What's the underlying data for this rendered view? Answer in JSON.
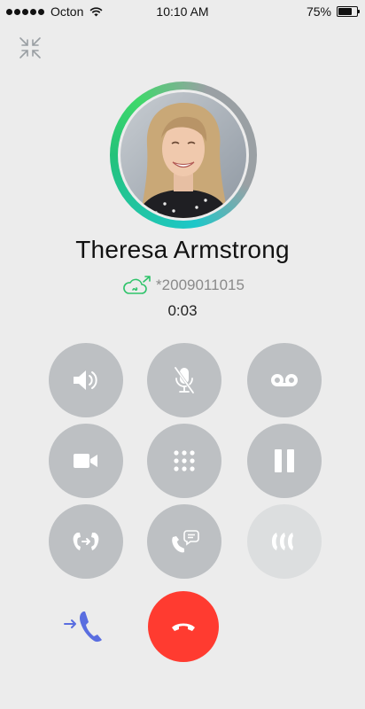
{
  "status_bar": {
    "carrier": "Octon",
    "time": "10:10 AM",
    "battery": "75%",
    "battery_level": 0.75
  },
  "contact": {
    "name": "Theresa Armstrong",
    "number": "*2009011015",
    "duration": "0:03"
  },
  "icons": {
    "collapse": "collapse-arrows-icon",
    "cloud_call": "cloud-outgoing-call-icon",
    "speaker": "speaker-icon",
    "mute": "microphone-off-icon",
    "voicemail": "voicemail-icon",
    "video": "video-camera-icon",
    "keypad": "dialpad-icon",
    "hold": "pause-icon",
    "transfer": "call-transfer-icon",
    "chat": "call-chat-icon",
    "conference": "conference-icon",
    "end_call": "end-call-icon",
    "transfer_call": "transfer-call-icon"
  },
  "colors": {
    "background": "#ececec",
    "control": "#bdc0c3",
    "control_disabled": "#dcdedf",
    "end_call": "#ff3b30",
    "accent_green": "#2ec36a",
    "accent_blue": "#5a6ee0"
  }
}
